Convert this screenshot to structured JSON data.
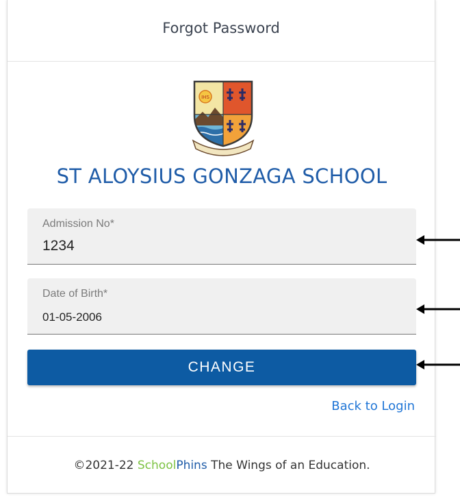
{
  "header": {
    "title": "Forgot Password"
  },
  "school": {
    "name": "ST ALOYSIUS GONZAGA SCHOOL"
  },
  "form": {
    "admission": {
      "label": "Admission No*",
      "value": "1234"
    },
    "dob": {
      "label": "Date of Birth*",
      "value": "01-05-2006"
    },
    "submit_label": "CHANGE",
    "back_link": "Back to Login"
  },
  "footer": {
    "copyright": "©2021-22",
    "brand_part1": "School",
    "brand_part2": "Phins",
    "tagline": "The Wings of an Education."
  },
  "colors": {
    "accent": "#0d5ba3",
    "school_name": "#1f5ca8",
    "link": "#1f75d6",
    "brand_green": "#7cc242"
  },
  "annotations": {
    "arrows": 3
  }
}
